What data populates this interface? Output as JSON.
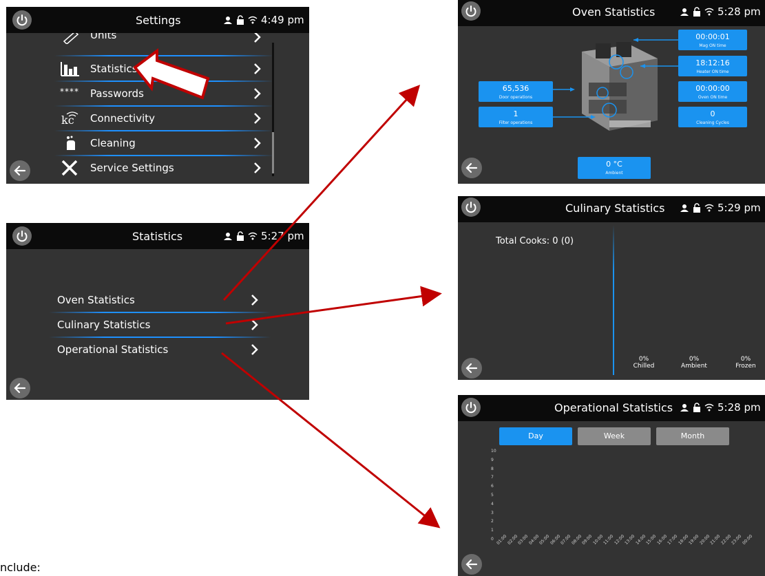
{
  "settings": {
    "title": "Settings",
    "time": "4:49 pm",
    "items": [
      {
        "label": "Units",
        "icon": "ruler-icon"
      },
      {
        "label": "Statistics",
        "icon": "bar-chart-icon"
      },
      {
        "label": "Passwords",
        "icon": "password-icon"
      },
      {
        "label": "Connectivity",
        "icon": "connectivity-icon"
      },
      {
        "label": "Cleaning",
        "icon": "cleaning-icon"
      },
      {
        "label": "Service Settings",
        "icon": "service-tools-icon"
      }
    ]
  },
  "statistics": {
    "title": "Statistics",
    "time": "5:27 pm",
    "items": [
      {
        "label": "Oven Statistics"
      },
      {
        "label": "Culinary Statistics"
      },
      {
        "label": "Operational Statistics"
      }
    ]
  },
  "oven": {
    "title": "Oven Statistics",
    "time": "5:28 pm",
    "boxes": {
      "mag": {
        "value": "00:00:01",
        "label": "Mag ON time"
      },
      "heater": {
        "value": "18:12:16",
        "label": "Heater ON time"
      },
      "ovenon": {
        "value": "00:00:00",
        "label": "Oven ON time"
      },
      "cleaning": {
        "value": "0",
        "label": "Cleaning Cycles"
      },
      "door": {
        "value": "65,536",
        "label": "Door operations"
      },
      "filter": {
        "value": "1",
        "label": "Filter operations"
      },
      "ambient": {
        "value": "0 °C",
        "label": "Ambient"
      }
    }
  },
  "culinary": {
    "title": "Culinary Statistics",
    "time": "5:29 pm",
    "total": "Total Cooks: 0 (0)",
    "cats": [
      {
        "pct": "0%",
        "label": "Chilled"
      },
      {
        "pct": "0%",
        "label": "Ambient"
      },
      {
        "pct": "0%",
        "label": "Frozen"
      }
    ]
  },
  "operational": {
    "title": "Operational Statistics",
    "time": "5:28 pm",
    "tabs": [
      "Day",
      "Week",
      "Month"
    ],
    "yticks": [
      "10",
      "9",
      "8",
      "7",
      "6",
      "5",
      "4",
      "3",
      "2",
      "1",
      "0"
    ],
    "xticks": [
      "01:00",
      "02:00",
      "03:00",
      "04:00",
      "05:00",
      "06:00",
      "07:00",
      "08:00",
      "09:00",
      "10:00",
      "11:00",
      "12:00",
      "13:00",
      "14:00",
      "15:00",
      "16:00",
      "17:00",
      "18:00",
      "19:00",
      "20:00",
      "21:00",
      "22:00",
      "23:00",
      "00:00"
    ]
  },
  "colors": {
    "accent": "#1a93f0",
    "screen_bg": "#333333",
    "topbar_bg": "#0b0b0b",
    "arrow": "#c00000",
    "tab_inactive": "#8a8a8a"
  },
  "footer_text": "nclude:"
}
